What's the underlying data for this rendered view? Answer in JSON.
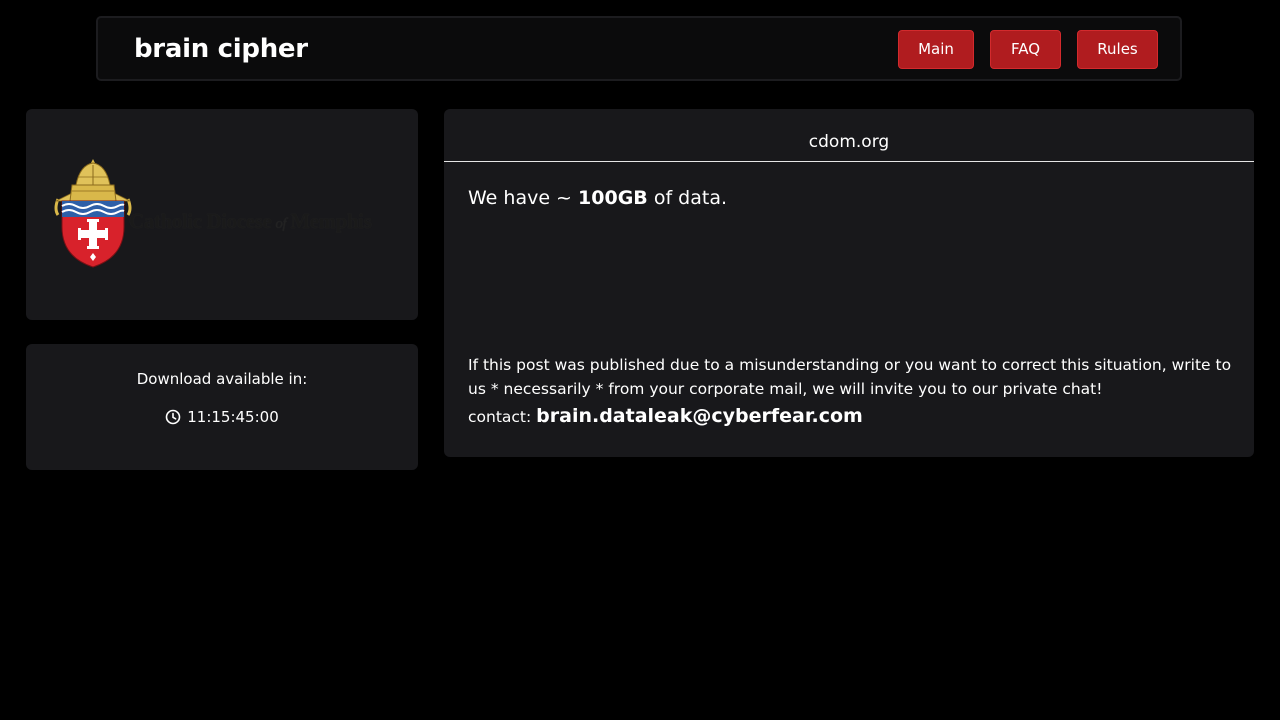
{
  "header": {
    "brand": "brain cipher",
    "nav": {
      "main": "Main",
      "faq": "FAQ",
      "rules": "Rules"
    }
  },
  "logo": {
    "text_part1": "Catholic Diocese",
    "text_of": "of",
    "text_part2": "Memphis"
  },
  "timer": {
    "label": "Download available in:",
    "value": "11:15:45:00",
    "icon": "clock-icon"
  },
  "post": {
    "title": "cdom.org",
    "data_prefix": "We have ~ ",
    "data_amount": "100GB",
    "data_suffix": " of data.",
    "notice": "If this post was published due to a misunderstanding or you want to correct this situation, write to us * necessarily * from your corporate mail, we will invite you to our private chat!",
    "contact_label": "contact: ",
    "contact_email": "brain.dataleak@cyberfear.com"
  },
  "colors": {
    "background": "#000000",
    "card": "#18181b",
    "button": "#b01c1f"
  }
}
